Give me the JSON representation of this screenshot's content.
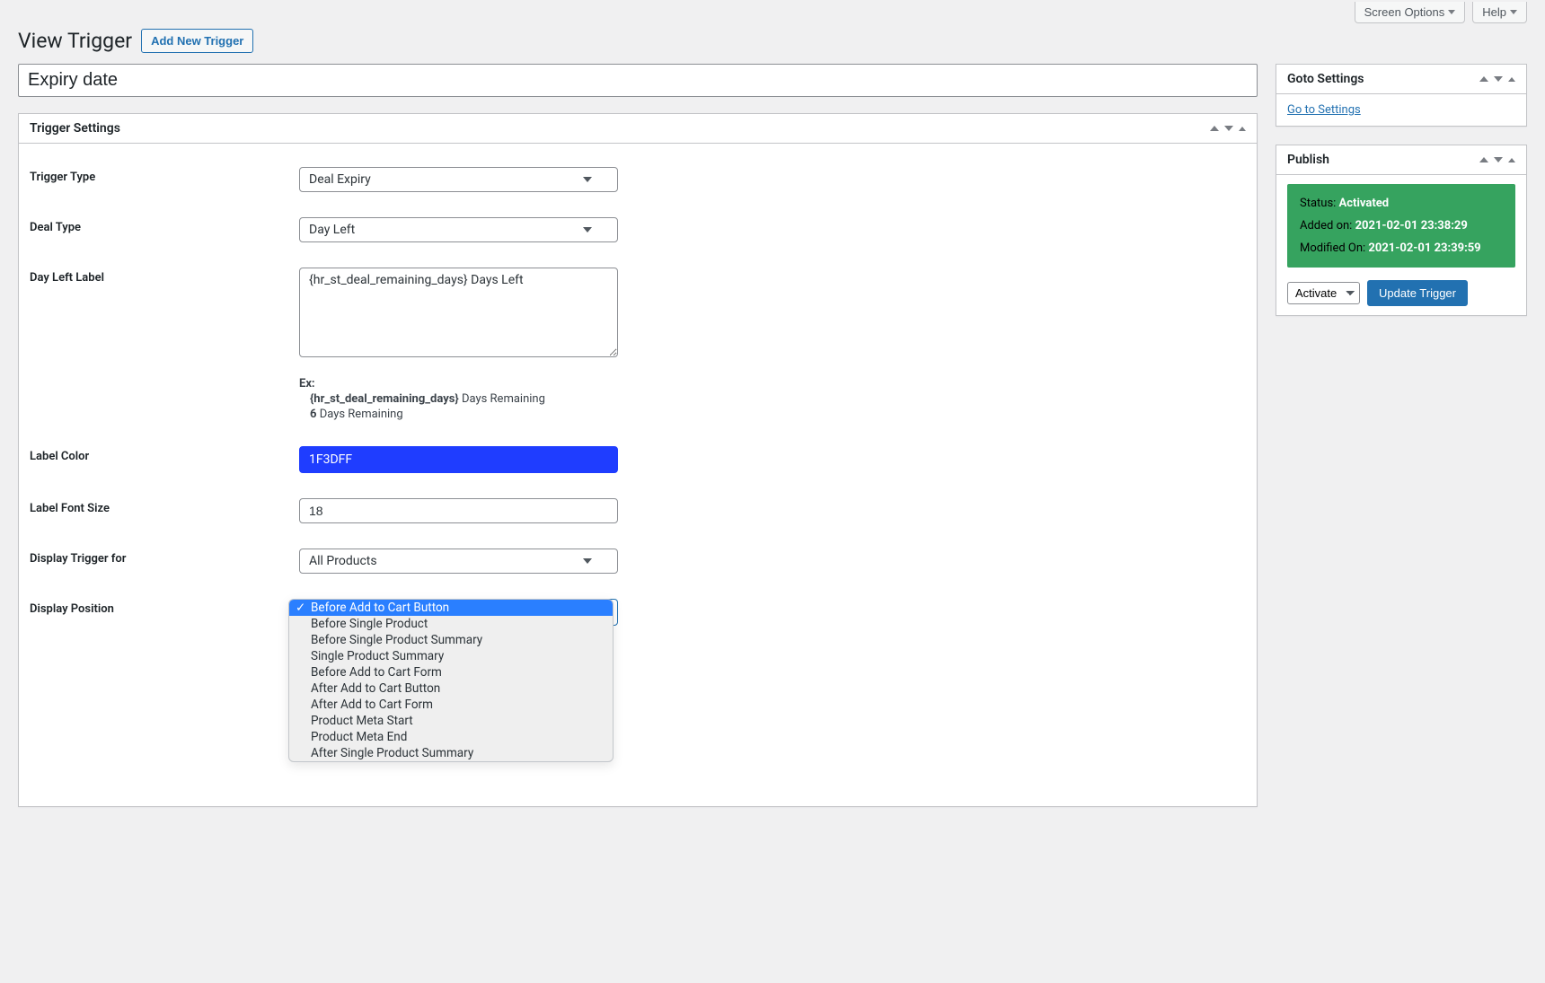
{
  "topTabs": {
    "screenOptions": "Screen Options",
    "help": "Help"
  },
  "header": {
    "title": "View Trigger",
    "addNew": "Add New Trigger"
  },
  "titleInput": "Expiry date",
  "triggerSettings": {
    "heading": "Trigger Settings",
    "fields": {
      "triggerTypeLabel": "Trigger Type",
      "triggerTypeValue": "Deal Expiry",
      "dealTypeLabel": "Deal Type",
      "dealTypeValue": "Day Left",
      "dayLeftLabel": "Day Left Label",
      "dayLeftValue": "{hr_st_deal_remaining_days} Days Left",
      "exLabel": "Ex:",
      "exLine1Token": "{hr_st_deal_remaining_days}",
      "exLine1Rest": " Days Remaining",
      "exLine2Num": "6",
      "exLine2Rest": " Days Remaining",
      "labelColorLabel": "Label Color",
      "labelColorValue": "1F3DFF",
      "labelFontSizeLabel": "Label Font Size",
      "labelFontSizeValue": "18",
      "displayForLabel": "Display Trigger for",
      "displayForValue": "All Products",
      "displayPositionLabel": "Display Position"
    },
    "displayPositionOptions": [
      "Before Add to Cart Button",
      "Before Single Product",
      "Before Single Product Summary",
      "Single Product Summary",
      "Before Add to Cart Form",
      "After Add to Cart Button",
      "After Add to Cart Form",
      "Product Meta Start",
      "Product Meta End",
      "After Single Product Summary"
    ]
  },
  "gotoBox": {
    "heading": "Goto Settings",
    "link": "Go to Settings"
  },
  "publishBox": {
    "heading": "Publish",
    "statusLabel": "Status: ",
    "statusValue": "Activated",
    "addedLabel": "Added on: ",
    "addedValue": "2021-02-01 23:38:29",
    "modifiedLabel": "Modified On: ",
    "modifiedValue": "2021-02-01 23:39:59",
    "activateOption": "Activate",
    "updateButton": "Update Trigger"
  }
}
